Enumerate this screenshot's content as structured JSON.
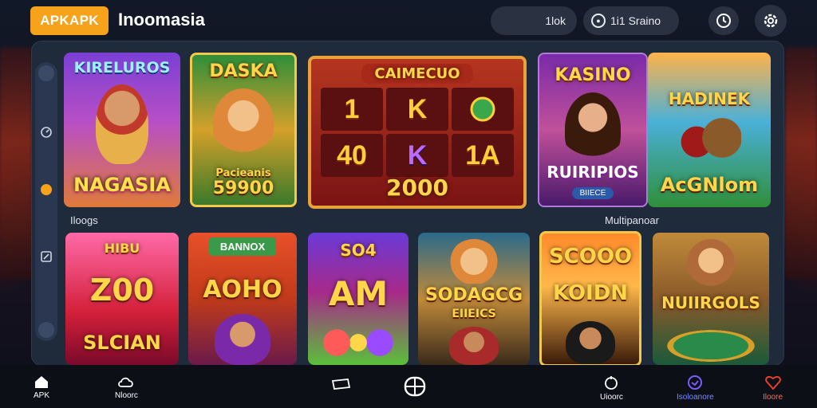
{
  "header": {
    "logo": "APKAPK",
    "title": "Inoomasia",
    "balance": "1lok",
    "scope_label": "1i1 Sraino"
  },
  "rail": {
    "icons": [
      "knob",
      "gauge-icon",
      "coin-icon",
      "edit-icon",
      "knob"
    ]
  },
  "sections": {
    "left_label": "Iloogs",
    "right_label": "Multipanoar"
  },
  "top_row": [
    {
      "title": "KIRELUROS",
      "subtitle": "NAGASIA"
    },
    {
      "title": "DASKA",
      "subtitle": "Pacieanis",
      "amount": "59900"
    },
    {
      "title": "CAIMECUO",
      "reels": [
        "1",
        "K",
        "",
        "40",
        "K",
        "1A"
      ],
      "amount": "2000"
    },
    {
      "title": "KASINO",
      "subtitle": "RUIRIPIOS",
      "badge": "BIIECE"
    },
    {
      "title": "HADINEK",
      "subtitle": "AcGNlom"
    }
  ],
  "bottom_row": [
    {
      "title": "HIBU",
      "subtitle": "Z00",
      "footer": "SLCIAN"
    },
    {
      "title": "BANNOX",
      "subtitle": "AOHO"
    },
    {
      "title": "SO4",
      "subtitle": "AM"
    },
    {
      "title": "SODAGCG",
      "subtitle": "EIIEICS"
    },
    {
      "title": "SCOOO",
      "subtitle": "KOIDN"
    },
    {
      "title": "NUIIRGOLS"
    }
  ],
  "bottom_nav": {
    "items": [
      {
        "label": "APK",
        "icon": "home-icon"
      },
      {
        "label": "Nloorc",
        "icon": "cloud-icon"
      },
      {
        "label": "",
        "icon": "cards-icon"
      },
      {
        "label": "",
        "icon": "grid-icon"
      },
      {
        "label": "Uioorc",
        "icon": "coin-icon"
      },
      {
        "label": "Isoloanore",
        "icon": "circle-icon"
      },
      {
        "label": "Iloore",
        "icon": "heart-icon"
      }
    ]
  },
  "colors": {
    "accent": "#f6a21a",
    "panel": "#1f2a3a",
    "gold": "#ffd54a"
  }
}
